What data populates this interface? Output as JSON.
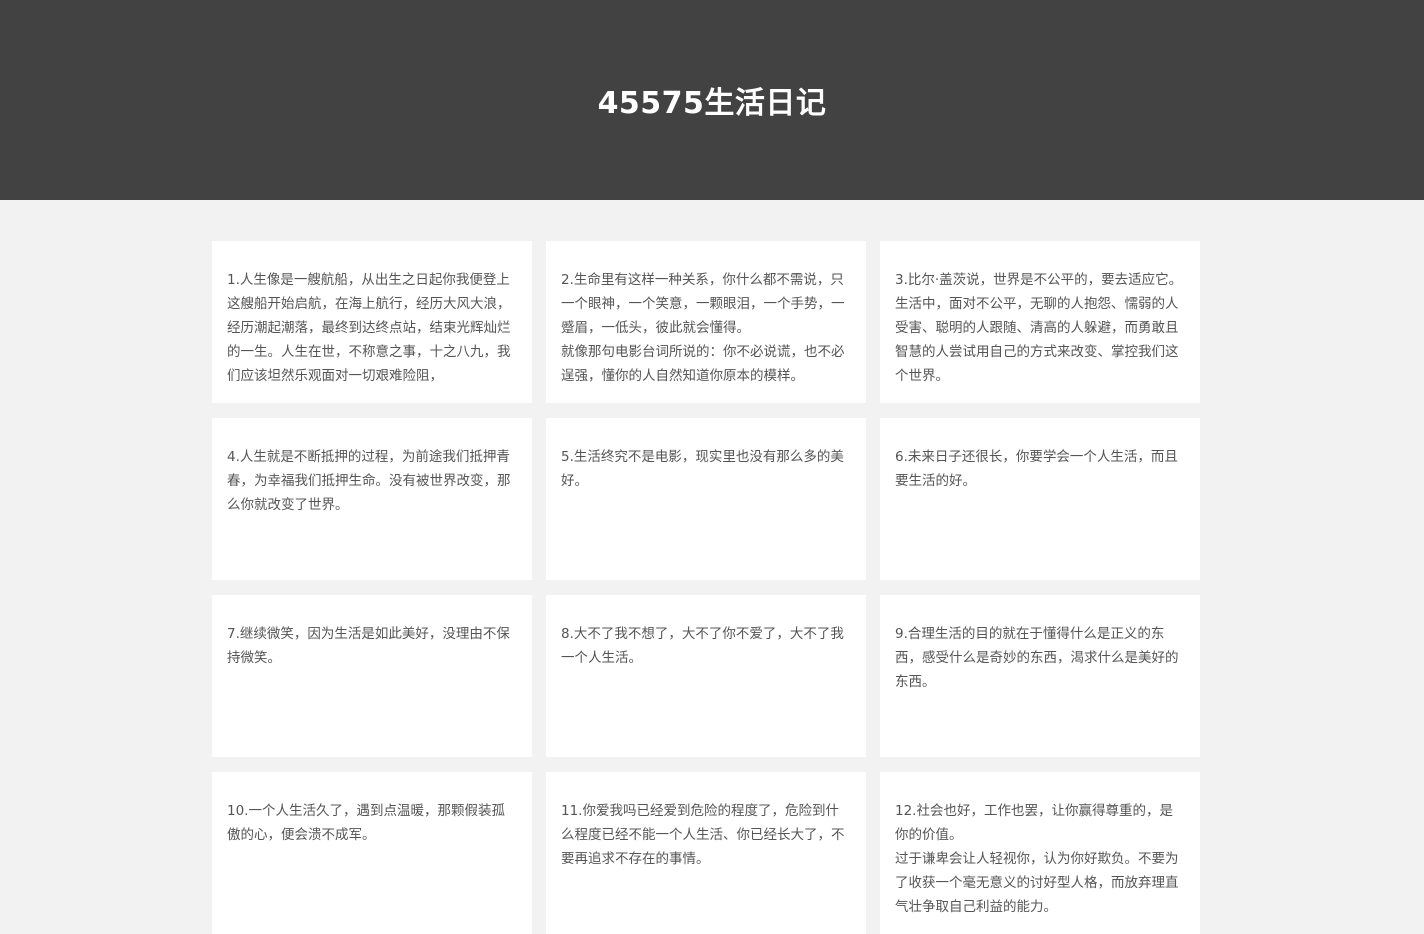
{
  "header": {
    "title": "45575生活日记"
  },
  "cards": [
    {
      "text": "1.人生像是一艘航船，从出生之日起你我便登上这艘船开始启航，在海上航行，经历大风大浪，经历潮起潮落，最终到达终点站，结束光辉灿烂的一生。人生在世，不称意之事，十之八九，我们应该坦然乐观面对一切艰难险阻，"
    },
    {
      "text": "2.生命里有这样一种关系，你什么都不需说，只一个眼神，一个笑意，一颗眼泪，一个手势，一蹙眉，一低头，彼此就会懂得。\n就像那句电影台词所说的：你不必说谎，也不必逞强，懂你的人自然知道你原本的模样。"
    },
    {
      "text": "3.比尔·盖茨说，世界是不公平的，要去适应它。生活中，面对不公平，无聊的人抱怨、懦弱的人受害、聪明的人跟随、清高的人躲避，而勇敢且智慧的人尝试用自己的方式来改变、掌控我们这个世界。"
    },
    {
      "text": "4.人生就是不断抵押的过程，为前途我们抵押青春，为幸福我们抵押生命。没有被世界改变，那么你就改变了世界。"
    },
    {
      "text": "5.生活终究不是电影，现实里也没有那么多的美好。"
    },
    {
      "text": "6.未来日子还很长，你要学会一个人生活，而且要生活的好。"
    },
    {
      "text": "7.继续微笑，因为生活是如此美好，没理由不保持微笑。"
    },
    {
      "text": "8.大不了我不想了，大不了你不爱了，大不了我一个人生活。"
    },
    {
      "text": "9.合理生活的目的就在于懂得什么是正义的东西，感受什么是奇妙的东西，渴求什么是美好的东西。"
    },
    {
      "text": "10.一个人生活久了，遇到点温暖，那颗假装孤傲的心，便会溃不成军。"
    },
    {
      "text": "11.你爱我吗已经爱到危险的程度了，危险到什么程度已经不能一个人生活、你已经长大了，不要再追求不存在的事情。"
    },
    {
      "text": "12.社会也好，工作也罢，让你赢得尊重的，是你的价值。\n过于谦卑会让人轻视你，认为你好欺负。不要为了收获一个毫无意义的讨好型人格，而放弃理直气壮争取自己利益的能力。"
    }
  ]
}
